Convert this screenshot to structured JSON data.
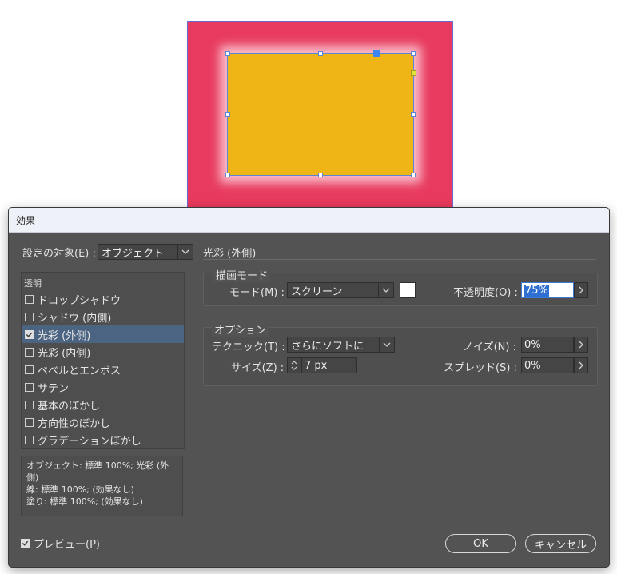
{
  "dialog": {
    "title": "効果",
    "target_label": "設定の対象(E) :",
    "target_value": "オブジェクト",
    "section_title": "光彩 (外側)"
  },
  "effects": {
    "header": "透明",
    "items": [
      {
        "label": "ドロップシャドウ",
        "checked": false,
        "selected": false
      },
      {
        "label": "シャドウ (内側)",
        "checked": false,
        "selected": false
      },
      {
        "label": "光彩 (外側)",
        "checked": true,
        "selected": true
      },
      {
        "label": "光彩 (内側)",
        "checked": false,
        "selected": false
      },
      {
        "label": "ベベルとエンボス",
        "checked": false,
        "selected": false
      },
      {
        "label": "サテン",
        "checked": false,
        "selected": false
      },
      {
        "label": "基本のぼかし",
        "checked": false,
        "selected": false
      },
      {
        "label": "方向性のぼかし",
        "checked": false,
        "selected": false
      },
      {
        "label": "グラデーションぼかし",
        "checked": false,
        "selected": false
      }
    ]
  },
  "summary": {
    "line1": "オブジェクト: 標準 100%; 光彩 (外",
    "line2": "側)",
    "line3": "線: 標準 100%; (効果なし)",
    "line4": "塗り: 標準 100%; (効果なし)"
  },
  "blend": {
    "group_title": "描画モード",
    "mode_label": "モード(M) :",
    "mode_value": "スクリーン",
    "swatch_color": "#ffffff",
    "opacity_label": "不透明度(O) :",
    "opacity_value": "75%"
  },
  "options": {
    "group_title": "オプション",
    "technique_label": "テクニック(T) :",
    "technique_value": "さらにソフトに",
    "size_label": "サイズ(Z) :",
    "size_value": "7 px",
    "noise_label": "ノイズ(N) :",
    "noise_value": "0%",
    "spread_label": "スプレッド(S) :",
    "spread_value": "0%"
  },
  "footer": {
    "preview_label": "プレビュー(P)",
    "preview_checked": true,
    "ok_label": "OK",
    "cancel_label": "キャンセル"
  },
  "colors": {
    "artboard": "#e83a5e",
    "object_fill": "#efb416",
    "dialog_bg": "#535353",
    "selection": "#4a6482"
  }
}
